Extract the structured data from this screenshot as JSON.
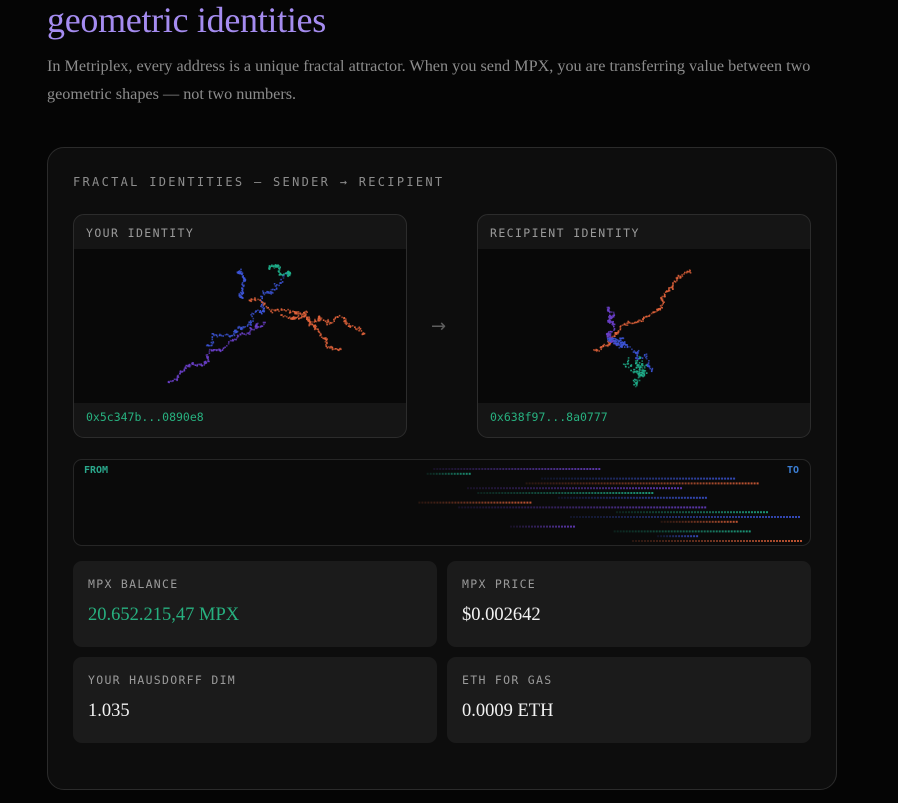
{
  "hero": {
    "title": "geometric identities",
    "description": "In Metriplex, every address is a unique fractal attractor. When you send MPX, you are transferring value between two geometric shapes — not two numbers."
  },
  "card": {
    "heading": "FRACTAL IDENTITIES — SENDER → RECIPIENT",
    "sender": {
      "label": "YOUR IDENTITY",
      "address": "0x5c347b...0890e8"
    },
    "recipient": {
      "label": "RECIPIENT IDENTITY",
      "address": "0x638f97...8a0777"
    },
    "arrow": "→",
    "strip": {
      "from_label": "FROM",
      "to_label": "TO"
    },
    "stats": [
      {
        "label": "MPX BALANCE",
        "value": "20.652.215,47 MPX"
      },
      {
        "label": "MPX PRICE",
        "value": "$0.002642"
      },
      {
        "label": "YOUR HAUSDORFF DIM",
        "value": "1.035"
      },
      {
        "label": "ETH FOR GAS",
        "value": "0.0009 ETH"
      }
    ]
  },
  "colors": {
    "accent_purple": "#a58cf0",
    "accent_green": "#27b07f",
    "accent_blue": "#3b7fd6",
    "fractal_orange": "#e0623a",
    "fractal_blue": "#3c55d8",
    "fractal_violet": "#6a3fc8",
    "fractal_teal": "#1fae8a"
  }
}
